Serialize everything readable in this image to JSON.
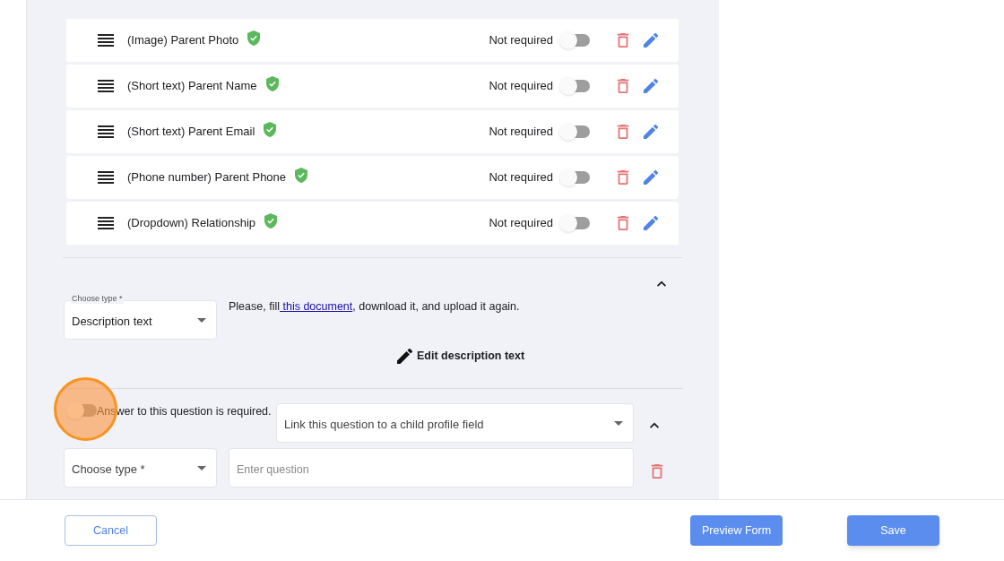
{
  "fields": [
    {
      "label": "(Image) Parent Photo",
      "verified": true,
      "required_label": "Not required",
      "required": false
    },
    {
      "label": "(Short text) Parent Name",
      "verified": true,
      "required_label": "Not required",
      "required": false
    },
    {
      "label": "(Short text) Parent Email",
      "verified": true,
      "required_label": "Not required",
      "required": false
    },
    {
      "label": "(Phone number) Parent Phone",
      "verified": true,
      "required_label": "Not required",
      "required": false
    },
    {
      "label": "(Dropdown) Relationship",
      "verified": true,
      "required_label": "Not required",
      "required": false
    }
  ],
  "description_block": {
    "expanded": true,
    "type_label": "Choose type *",
    "type_value": "Description text",
    "text_before": "Please, fill",
    "link": " this document",
    "text_after": ", download it, and upload it again.",
    "edit_button": "Edit description text"
  },
  "question_block": {
    "expanded": true,
    "required": false,
    "required_label": "Answer to this question is required.",
    "link_placeholder": "Link this question to a child profile field",
    "type_placeholder": "Choose type *",
    "question_placeholder": "Enter question"
  },
  "footer": {
    "cancel": "Cancel",
    "preview": "Preview Form",
    "save": "Save"
  }
}
